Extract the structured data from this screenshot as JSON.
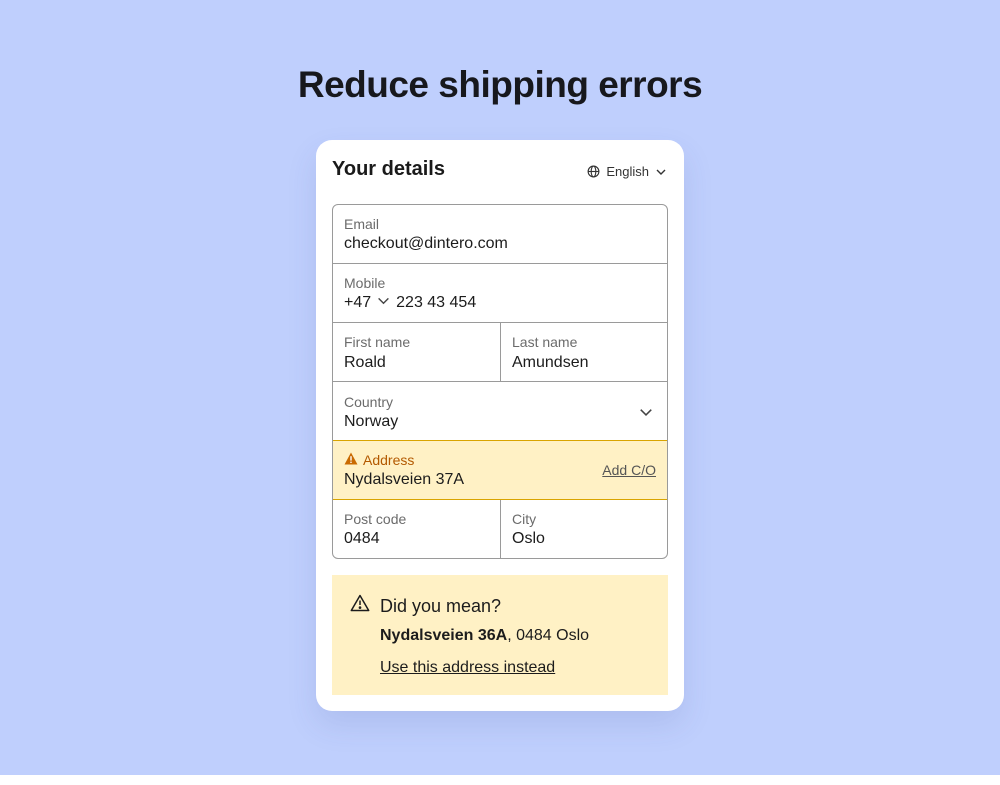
{
  "headline": "Reduce shipping errors",
  "card": {
    "title": "Your details",
    "language": "English"
  },
  "form": {
    "email": {
      "label": "Email",
      "value": "checkout@dintero.com"
    },
    "mobile": {
      "label": "Mobile",
      "country_code": "+47",
      "value": "223 43 454"
    },
    "first_name": {
      "label": "First name",
      "value": "Roald"
    },
    "last_name": {
      "label": "Last name",
      "value": "Amundsen"
    },
    "country": {
      "label": "Country",
      "value": "Norway"
    },
    "address": {
      "label": "Address",
      "value": "Nydalsveien 37A",
      "add_co": "Add C/O"
    },
    "post_code": {
      "label": "Post code",
      "value": "0484"
    },
    "city": {
      "label": "City",
      "value": "Oslo"
    }
  },
  "suggestion": {
    "title": "Did you mean?",
    "street": "Nydalsveien 36A",
    "rest": ", 0484 Oslo",
    "action": "Use this address instead"
  },
  "colors": {
    "background": "#bfcffd",
    "warning_bg": "#fff1c5",
    "warning_text": "#b35900",
    "warning_border": "#d9a400"
  },
  "icons": {
    "language": "globe-icon",
    "dropdown": "chevron-down-icon",
    "address_warning": "warning-icon",
    "suggestion": "warning-outline-icon"
  }
}
